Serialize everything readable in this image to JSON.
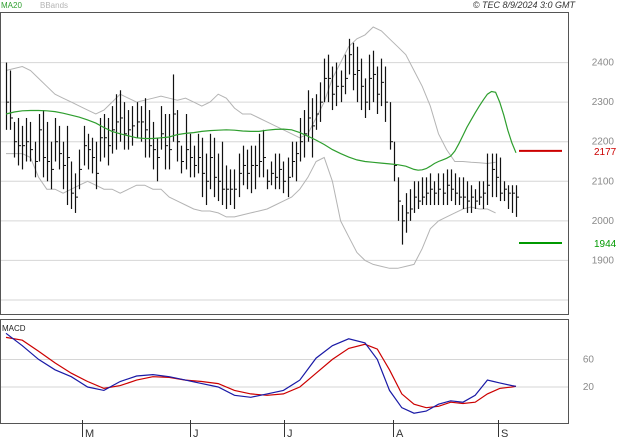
{
  "header": {
    "legend": [
      {
        "label": "MA20",
        "color": "#2e9e2e"
      },
      {
        "label": "BBands",
        "color": "#b4b4b4"
      }
    ],
    "credit": "© TEC 8/9/2024 3:0 GMT"
  },
  "macd_label": "MACD",
  "chart_data": [
    {
      "type": "ohlc",
      "ylim": [
        1800,
        2500
      ],
      "yticks": [
        1900,
        2000,
        2100,
        2200,
        2300,
        2400
      ],
      "xlabels": [
        "M",
        "J",
        "J",
        "A",
        "S"
      ],
      "x": [
        0,
        2,
        4,
        6,
        8,
        10,
        12,
        14,
        16,
        18,
        20,
        22,
        24,
        26,
        28,
        30,
        32,
        34,
        36,
        38,
        40,
        42,
        44,
        46,
        48,
        50,
        52,
        54,
        56,
        58,
        60,
        62,
        64,
        66,
        68,
        70,
        72,
        74,
        76,
        78,
        80,
        82,
        84,
        86,
        88,
        90,
        92,
        94,
        96,
        98,
        100,
        102,
        104,
        106,
        108,
        110,
        112,
        114,
        116,
        118,
        120,
        122,
        124,
        126,
        128,
        130,
        132,
        134,
        136,
        138,
        140,
        142,
        144,
        146,
        148,
        150,
        152,
        154,
        156,
        158,
        160,
        162,
        164,
        166,
        168,
        170,
        172,
        174,
        176,
        178,
        180,
        182,
        184,
        186,
        188,
        190,
        192,
        194,
        196,
        198,
        200,
        202,
        204,
        206,
        208,
        210,
        212,
        214,
        216,
        218,
        220,
        222,
        224,
        226,
        228,
        230,
        232,
        234,
        236,
        238,
        240,
        242,
        244,
        246,
        248,
        250
      ],
      "high": [
        2400,
        2380,
        2250,
        2260,
        2240,
        2260,
        2250,
        2200,
        2270,
        2280,
        2250,
        2200,
        2260,
        2240,
        2200,
        2240,
        2150,
        2120,
        2180,
        2240,
        2220,
        2210,
        2200,
        2260,
        2270,
        2260,
        2290,
        2320,
        2330,
        2300,
        2280,
        2290,
        2300,
        2290,
        2310,
        2280,
        2250,
        2210,
        2290,
        2270,
        2270,
        2370,
        2280,
        2190,
        2270,
        2220,
        2190,
        2220,
        2210,
        2170,
        2220,
        2210,
        2170,
        2200,
        2140,
        2130,
        2130,
        2170,
        2190,
        2180,
        2190,
        2190,
        2220,
        2230,
        2130,
        2150,
        2170,
        2170,
        2150,
        2160,
        2200,
        2200,
        2260,
        2280,
        2330,
        2310,
        2320,
        2350,
        2410,
        2420,
        2390,
        2400,
        2380,
        2420,
        2460,
        2450,
        2440,
        2410,
        2360,
        2420,
        2430,
        2390,
        2410,
        2390,
        2300,
        2200,
        2110,
        2040,
        2070,
        2080,
        2100,
        2100,
        2110,
        2110,
        2120,
        2100,
        2120,
        2120,
        2130,
        2130,
        2120,
        2110,
        2110,
        2100,
        2090,
        2080,
        2100,
        2100,
        2170,
        2170,
        2170,
        2160,
        2100,
        2090,
        2090,
        2090
      ],
      "low": [
        2230,
        2230,
        2160,
        2140,
        2130,
        2150,
        2150,
        2110,
        2150,
        2110,
        2100,
        2080,
        2150,
        2130,
        2080,
        2040,
        2030,
        2020,
        2080,
        2140,
        2130,
        2120,
        2080,
        2150,
        2160,
        2140,
        2170,
        2180,
        2200,
        2180,
        2180,
        2190,
        2210,
        2200,
        2160,
        2160,
        2130,
        2100,
        2180,
        2130,
        2130,
        2200,
        2150,
        2120,
        2130,
        2110,
        2110,
        2120,
        2060,
        2040,
        2080,
        2060,
        2050,
        2040,
        2030,
        2040,
        2030,
        2060,
        2090,
        2080,
        2070,
        2080,
        2110,
        2110,
        2080,
        2090,
        2080,
        2080,
        2070,
        2060,
        2110,
        2100,
        2150,
        2160,
        2200,
        2160,
        2230,
        2250,
        2300,
        2300,
        2280,
        2290,
        2300,
        2320,
        2370,
        2330,
        2300,
        2280,
        2260,
        2280,
        2300,
        2270,
        2290,
        2250,
        2180,
        2100,
        2000,
        1940,
        1970,
        2000,
        2020,
        2030,
        2040,
        2040,
        2040,
        2040,
        2040,
        2040,
        2040,
        2050,
        2040,
        2040,
        2030,
        2020,
        2020,
        2030,
        2040,
        2030,
        2040,
        2060,
        2060,
        2050,
        2050,
        2030,
        2020,
        2010
      ],
      "close": [
        2300,
        2260,
        2200,
        2190,
        2190,
        2200,
        2180,
        2150,
        2230,
        2160,
        2150,
        2130,
        2200,
        2170,
        2140,
        2160,
        2070,
        2060,
        2130,
        2190,
        2180,
        2160,
        2120,
        2210,
        2210,
        2190,
        2230,
        2250,
        2260,
        2220,
        2230,
        2240,
        2250,
        2250,
        2230,
        2190,
        2180,
        2160,
        2220,
        2190,
        2180,
        2270,
        2200,
        2150,
        2180,
        2160,
        2140,
        2160,
        2120,
        2100,
        2160,
        2110,
        2100,
        2080,
        2080,
        2080,
        2080,
        2120,
        2140,
        2120,
        2140,
        2140,
        2150,
        2160,
        2100,
        2120,
        2110,
        2130,
        2100,
        2110,
        2150,
        2170,
        2200,
        2220,
        2260,
        2240,
        2270,
        2300,
        2360,
        2360,
        2320,
        2340,
        2340,
        2360,
        2420,
        2370,
        2380,
        2340,
        2300,
        2360,
        2370,
        2320,
        2350,
        2300,
        2200,
        2140,
        2050,
        2000,
        2020,
        2030,
        2060,
        2050,
        2060,
        2070,
        2080,
        2070,
        2080,
        2070,
        2090,
        2080,
        2070,
        2060,
        2060,
        2050,
        2060,
        2050,
        2060,
        2070,
        2090,
        2130,
        2110,
        2070,
        2080,
        2070,
        2070,
        2060
      ],
      "ma20": [
        2270,
        2275,
        2278,
        2279,
        2279,
        2278,
        2276,
        2272,
        2267,
        2262,
        2255,
        2247,
        2236,
        2226,
        2220,
        2215,
        2210,
        2208,
        2208,
        2210,
        2212,
        2218,
        2221,
        2223,
        2226,
        2228,
        2229,
        2230,
        2229,
        2227,
        2226,
        2226,
        2229,
        2231,
        2232,
        2230,
        2223,
        2214,
        2204,
        2193,
        2180,
        2170,
        2161,
        2154,
        2150,
        2148,
        2146,
        2144,
        2142,
        2138,
        2134,
        2130,
        2128,
        2129,
        2132,
        2138,
        2145,
        2150,
        2154,
        2158,
        2164,
        2176,
        2195,
        2216,
        2237,
        2255,
        2273,
        2290,
        2306,
        2320,
        2327,
        2325,
        2300,
        2267,
        2229,
        2197,
        2172,
        2147,
        2122,
        2108,
        2095,
        2088,
        2087,
        2085,
        2087,
        2088,
        2087,
        2088,
        2090,
        2092
      ],
      "ma20_x": [
        0,
        4,
        8,
        12,
        16,
        20,
        24,
        28,
        32,
        36,
        40,
        44,
        48,
        52,
        56,
        60,
        64,
        68,
        72,
        76,
        80,
        84,
        88,
        92,
        96,
        100,
        104,
        108,
        112,
        116,
        120,
        124,
        128,
        132,
        136,
        140,
        144,
        148,
        152,
        156,
        160,
        164,
        168,
        172,
        176,
        180,
        184,
        188,
        192,
        196,
        198,
        200,
        202,
        204,
        206,
        208,
        210,
        212,
        214,
        216,
        218,
        220,
        222,
        224,
        226,
        228,
        230,
        232,
        234,
        236,
        238,
        240,
        242,
        244,
        246,
        248,
        250
      ],
      "bb_upper": [
        2380,
        2385,
        2390,
        2380,
        2360,
        2340,
        2320,
        2310,
        2300,
        2290,
        2280,
        2270,
        2280,
        2300,
        2320,
        2310,
        2300,
        2305,
        2310,
        2315,
        2310,
        2305,
        2310,
        2300,
        2290,
        2300,
        2320,
        2310,
        2285,
        2270,
        2270,
        2260,
        2250,
        2240,
        2230,
        2220,
        2210,
        2220,
        2260,
        2300,
        2360,
        2400,
        2440,
        2460,
        2470,
        2490,
        2480,
        2460,
        2440,
        2420,
        2380,
        2340,
        2290,
        2220,
        2180,
        2150,
        2150,
        2148,
        2147,
        2145,
        2148
      ],
      "bb_lower": [
        2170,
        2170,
        2170,
        2160,
        2110,
        2080,
        2080,
        2070,
        2080,
        2090,
        2100,
        2090,
        2080,
        2080,
        2070,
        2080,
        2090,
        2090,
        2080,
        2080,
        2060,
        2050,
        2040,
        2030,
        2025,
        2025,
        2020,
        2010,
        2010,
        2015,
        2020,
        2025,
        2030,
        2040,
        2050,
        2060,
        2080,
        2110,
        2150,
        2160,
        2100,
        2000,
        1960,
        1920,
        1900,
        1890,
        1885,
        1880,
        1880,
        1885,
        1890,
        1930,
        1980,
        2000,
        2010,
        2020,
        2030,
        2035,
        2030,
        2030,
        2020
      ],
      "bb_x": [
        0,
        4,
        8,
        12,
        16,
        20,
        24,
        28,
        32,
        36,
        40,
        44,
        48,
        52,
        56,
        60,
        64,
        68,
        72,
        76,
        80,
        84,
        88,
        92,
        96,
        100,
        104,
        108,
        112,
        116,
        120,
        124,
        128,
        132,
        136,
        140,
        144,
        148,
        152,
        156,
        160,
        164,
        168,
        172,
        176,
        180,
        184,
        188,
        192,
        196,
        200,
        204,
        208,
        212,
        216,
        220,
        224,
        228,
        232,
        236,
        240
      ],
      "annotations": [
        {
          "value": 2177,
          "label": "2177",
          "color": "#cc0000"
        },
        {
          "value": 1944,
          "label": "1944",
          "color": "#009900"
        }
      ]
    },
    {
      "type": "line",
      "name": "MACD",
      "ylim": [
        -25,
        110
      ],
      "yticks": [
        20,
        60
      ],
      "x": [
        0,
        8,
        16,
        24,
        32,
        40,
        48,
        56,
        64,
        72,
        80,
        88,
        96,
        104,
        112,
        120,
        128,
        136,
        144,
        152,
        160,
        168,
        176,
        182,
        188,
        194,
        200,
        206,
        212,
        218,
        224,
        230,
        236,
        242,
        248,
        250
      ],
      "macd": [
        98,
        80,
        60,
        45,
        35,
        20,
        15,
        28,
        36,
        38,
        35,
        30,
        25,
        20,
        8,
        5,
        10,
        15,
        30,
        62,
        80,
        90,
        84,
        60,
        15,
        -10,
        -18,
        -15,
        -5,
        0,
        -2,
        8,
        30,
        26,
        22,
        21
      ],
      "signal": [
        92,
        88,
        72,
        55,
        40,
        28,
        18,
        22,
        30,
        35,
        34,
        30,
        28,
        25,
        15,
        10,
        8,
        10,
        20,
        40,
        60,
        76,
        82,
        75,
        45,
        10,
        -5,
        -10,
        -8,
        -2,
        -4,
        -2,
        10,
        18,
        20,
        21
      ]
    }
  ]
}
